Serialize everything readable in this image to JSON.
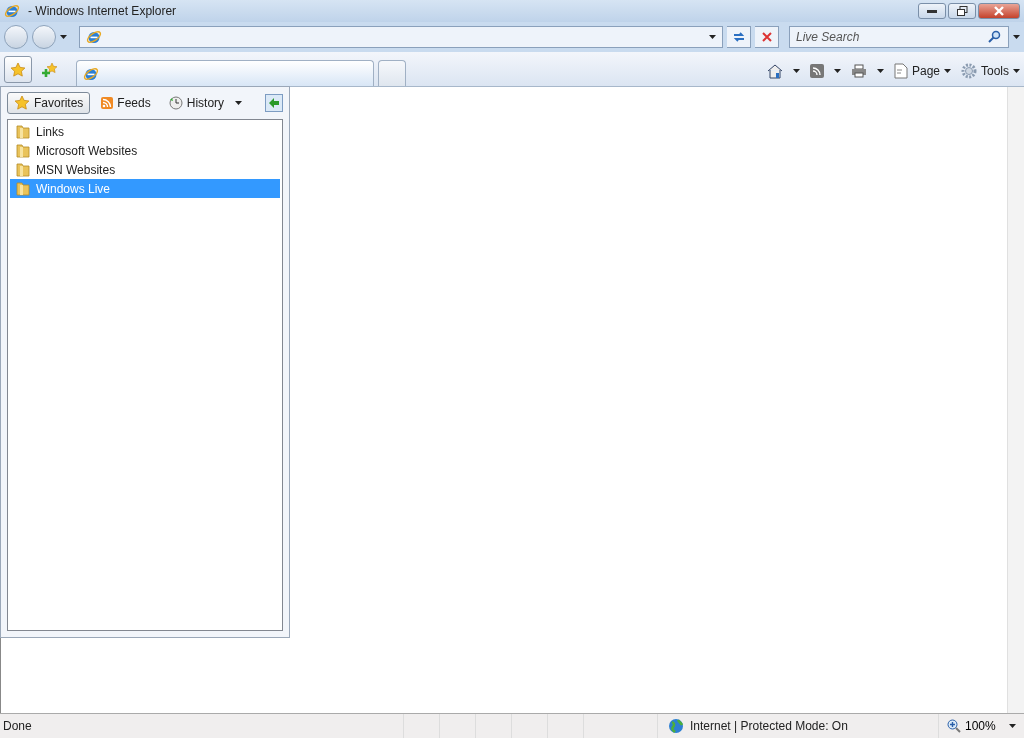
{
  "window": {
    "title": "- Windows Internet Explorer"
  },
  "search": {
    "placeholder": "Live Search"
  },
  "command_bar": [
    {
      "label": "Page"
    },
    {
      "label": "Tools"
    }
  ],
  "favorites_center": {
    "tabs": [
      {
        "label": "Favorites",
        "selected": true
      },
      {
        "label": "Feeds",
        "selected": false
      },
      {
        "label": "History",
        "selected": false
      }
    ],
    "items": [
      {
        "label": "Links",
        "selected": false
      },
      {
        "label": "Microsoft Websites",
        "selected": false
      },
      {
        "label": "MSN Websites",
        "selected": false
      },
      {
        "label": "Windows Live",
        "selected": true
      }
    ]
  },
  "status_bar": {
    "status": "Done",
    "zone": "Internet | Protected Mode: On",
    "zoom": "100%"
  }
}
